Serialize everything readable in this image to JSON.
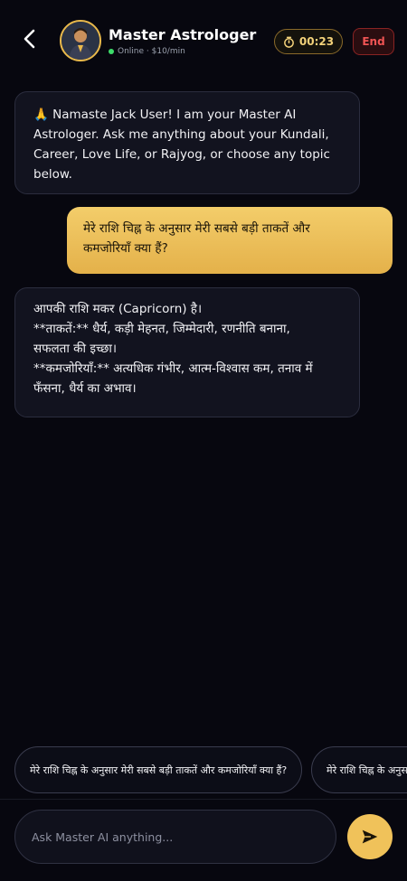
{
  "header": {
    "title": "Master Astrologer",
    "status": "Online · $10/min",
    "timer": "00:23",
    "end_label": "End"
  },
  "messages": [
    {
      "sender": "ai",
      "lines": [
        "🙏 Namaste Jack User! I am your Master AI",
        "Astrologer. Ask me anything about your Kundali,",
        "Career, Love Life, or Rajyog, or choose any topic",
        "below."
      ]
    },
    {
      "sender": "user",
      "lines": [
        "मेरे राशि चिह्न के अनुसार मेरी सबसे बड़ी ताकतें और",
        "कमजोरियाँ क्या हैं?"
      ]
    },
    {
      "sender": "ai",
      "lines": [
        "आपकी राशि मकर (Capricorn) है।",
        "**ताकतें:** धैर्य, कड़ी मेहनत, जिम्मेदारी, रणनीति बनाना,",
        "सफलता की इच्छा।",
        "**कमजोरियाँ:** अत्यधिक गंभीर, आत्म-विश्वास कम, तनाव में",
        "फँसना, धैर्य का अभाव।"
      ]
    }
  ],
  "suggestions": [
    "मेरे राशि चिह्न के अनुसार मेरी सबसे बड़ी ताकतें और कमजोरियाँ क्या हैं?",
    "मेरे राशि चिह्न के अनुसार"
  ],
  "input": {
    "placeholder": "Ask Master AI anything...",
    "value": ""
  },
  "icons": {
    "back": "chevron-left-icon",
    "timer": "stopwatch-icon",
    "send": "send-icon"
  },
  "colors": {
    "accent": "#f0c25a",
    "background": "#07070f",
    "end": "#f05454",
    "online": "#3ddc6a"
  }
}
